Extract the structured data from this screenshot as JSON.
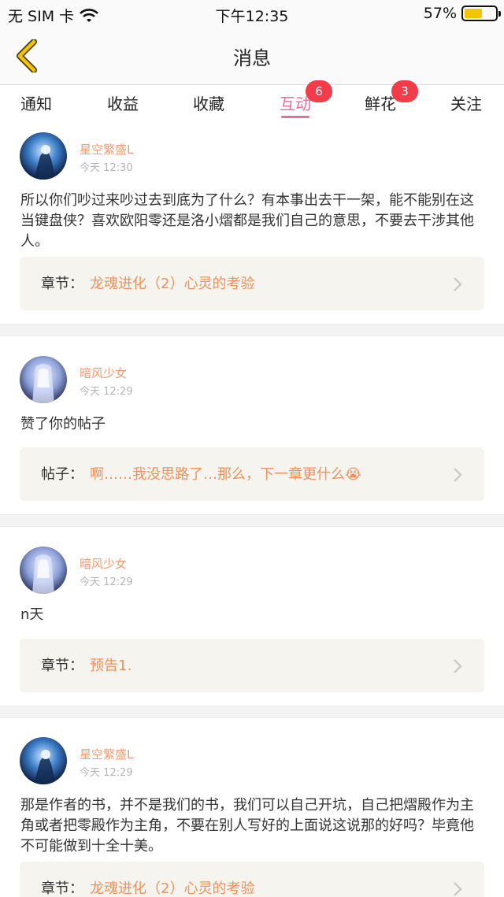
{
  "status_bar": {
    "carrier": "无 SIM 卡",
    "time": "下午12:35",
    "battery_percent": "57%",
    "battery_level": 0.57,
    "wifi_icon": "wifi-icon",
    "battery_color": "#f5c400"
  },
  "nav": {
    "title": "消息",
    "back_icon": "chevron-left-icon",
    "accent_color": "#f5c400"
  },
  "tabs": [
    {
      "label": "通知",
      "badge": ""
    },
    {
      "label": "收益",
      "badge": ""
    },
    {
      "label": "收藏",
      "badge": ""
    },
    {
      "label": "互动",
      "badge": "6",
      "active": true
    },
    {
      "label": "鲜花",
      "badge": "3"
    },
    {
      "label": "关注",
      "badge": ""
    }
  ],
  "feed": [
    {
      "user": "星空繁盛L",
      "time": "今天 12:30",
      "text": "所以你们吵过来吵过去到底为了什么？有本事出去干一架，能不能别在这当键盘侠？喜欢欧阳零还是洛小熠都是我们自己的意思，不要去干涉其他人。",
      "ref_label": "章节：",
      "ref_value": "龙魂进化（2）心灵的考验"
    },
    {
      "user": "暗风少女",
      "time": "今天 12:29",
      "text": "赞了你的帖子",
      "ref_label": "帖子：",
      "ref_value": "啊……我没思路了…那么，下一章更什么😭"
    },
    {
      "user": "暗风少女",
      "time": "今天 12:29",
      "text": "n天",
      "ref_label": "章节：",
      "ref_value": "预告1."
    },
    {
      "user": "星空繁盛L",
      "time": "今天 12:29",
      "text": "那是作者的书，并不是我们的书，我们可以自己开坑，自己把熠殿作为主角或者把零殿作为主角，不要在别人写好的上面说这说那的好吗？毕竟他不可能做到十全十美。",
      "ref_label": "章节：",
      "ref_value": "龙魂进化（2）心灵的考验"
    }
  ],
  "colors": {
    "active_tab": "#e76d9a",
    "username": "#f29b72",
    "ref_value": "#f0905b",
    "badge": "#f23c4a"
  }
}
